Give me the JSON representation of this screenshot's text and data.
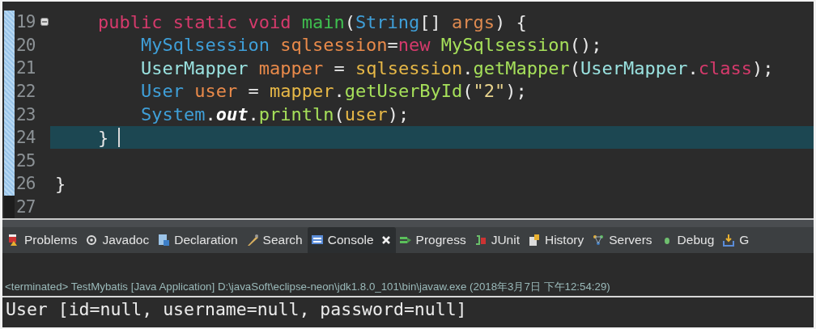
{
  "editor": {
    "lines": [
      {
        "number": "19",
        "fold": true,
        "current": false,
        "tokens": [
          {
            "text": "    public static void ",
            "kind": "keyword"
          },
          {
            "text": "main",
            "kind": "method-decl"
          },
          {
            "text": "(",
            "kind": "plain"
          },
          {
            "text": "String",
            "kind": "type"
          },
          {
            "text": "[] ",
            "kind": "plain"
          },
          {
            "text": "args",
            "kind": "param"
          },
          {
            "text": ") {",
            "kind": "plain"
          }
        ]
      },
      {
        "number": "20",
        "fold": false,
        "current": false,
        "tokens": [
          {
            "text": "        MySqlsession ",
            "kind": "type"
          },
          {
            "text": "sqlsession",
            "kind": "local-decl"
          },
          {
            "text": "=",
            "kind": "plain"
          },
          {
            "text": "new ",
            "kind": "keyword"
          },
          {
            "text": "MySqlsession",
            "kind": "method"
          },
          {
            "text": "();",
            "kind": "plain"
          }
        ]
      },
      {
        "number": "21",
        "fold": false,
        "current": false,
        "tokens": [
          {
            "text": "        UserMapper ",
            "kind": "interface"
          },
          {
            "text": "mapper",
            "kind": "local-decl"
          },
          {
            "text": " = ",
            "kind": "plain"
          },
          {
            "text": "sqlsession",
            "kind": "local-ref"
          },
          {
            "text": ".",
            "kind": "plain"
          },
          {
            "text": "getMapper",
            "kind": "method"
          },
          {
            "text": "(",
            "kind": "plain"
          },
          {
            "text": "UserMapper",
            "kind": "interface"
          },
          {
            "text": ".",
            "kind": "plain"
          },
          {
            "text": "class",
            "kind": "keyword"
          },
          {
            "text": ");",
            "kind": "plain"
          }
        ]
      },
      {
        "number": "22",
        "fold": false,
        "current": false,
        "tokens": [
          {
            "text": "        User ",
            "kind": "type"
          },
          {
            "text": "user",
            "kind": "local-decl"
          },
          {
            "text": " = ",
            "kind": "plain"
          },
          {
            "text": "mapper",
            "kind": "local-ref"
          },
          {
            "text": ".",
            "kind": "plain"
          },
          {
            "text": "getUserById",
            "kind": "method"
          },
          {
            "text": "(",
            "kind": "plain"
          },
          {
            "text": "\"2\"",
            "kind": "string"
          },
          {
            "text": ");",
            "kind": "plain"
          }
        ]
      },
      {
        "number": "23",
        "fold": false,
        "current": false,
        "tokens": [
          {
            "text": "        System",
            "kind": "type"
          },
          {
            "text": ".",
            "kind": "plain"
          },
          {
            "text": "out",
            "kind": "static-field"
          },
          {
            "text": ".",
            "kind": "plain"
          },
          {
            "text": "println",
            "kind": "method"
          },
          {
            "text": "(",
            "kind": "plain"
          },
          {
            "text": "user",
            "kind": "local-ref"
          },
          {
            "text": ");",
            "kind": "plain"
          }
        ]
      },
      {
        "number": "24",
        "fold": false,
        "current": true,
        "tokens": [
          {
            "text": "    }",
            "kind": "plain"
          }
        ]
      },
      {
        "number": "25",
        "fold": false,
        "current": false
      },
      {
        "number": "26",
        "fold": false,
        "current": false,
        "tokens": [
          {
            "text": "}",
            "kind": "plain"
          }
        ]
      },
      {
        "number": "27",
        "fold": false,
        "current": false
      }
    ]
  },
  "tabs": [
    {
      "label": "Problems",
      "selected": false,
      "closable": false
    },
    {
      "label": "Javadoc",
      "selected": false,
      "closable": false
    },
    {
      "label": "Declaration",
      "selected": false,
      "closable": false
    },
    {
      "label": "Search",
      "selected": false,
      "closable": false
    },
    {
      "label": "Console",
      "selected": true,
      "closable": true
    },
    {
      "label": "Progress",
      "selected": false,
      "closable": false
    },
    {
      "label": "JUnit",
      "selected": false,
      "closable": false
    },
    {
      "label": "History",
      "selected": false,
      "closable": false
    },
    {
      "label": "Servers",
      "selected": false,
      "closable": false
    },
    {
      "label": "Debug",
      "selected": false,
      "closable": false
    },
    {
      "label": "G",
      "selected": false,
      "closable": false
    }
  ],
  "console": {
    "status": "<terminated> TestMybatis [Java Application] D:\\javaSoft\\eclipse-neon\\jdk1.8.0_101\\bin\\javaw.exe (2018年3月7日 下午12:54:29)",
    "output": "User [id=null, username=null, password=null]"
  }
}
